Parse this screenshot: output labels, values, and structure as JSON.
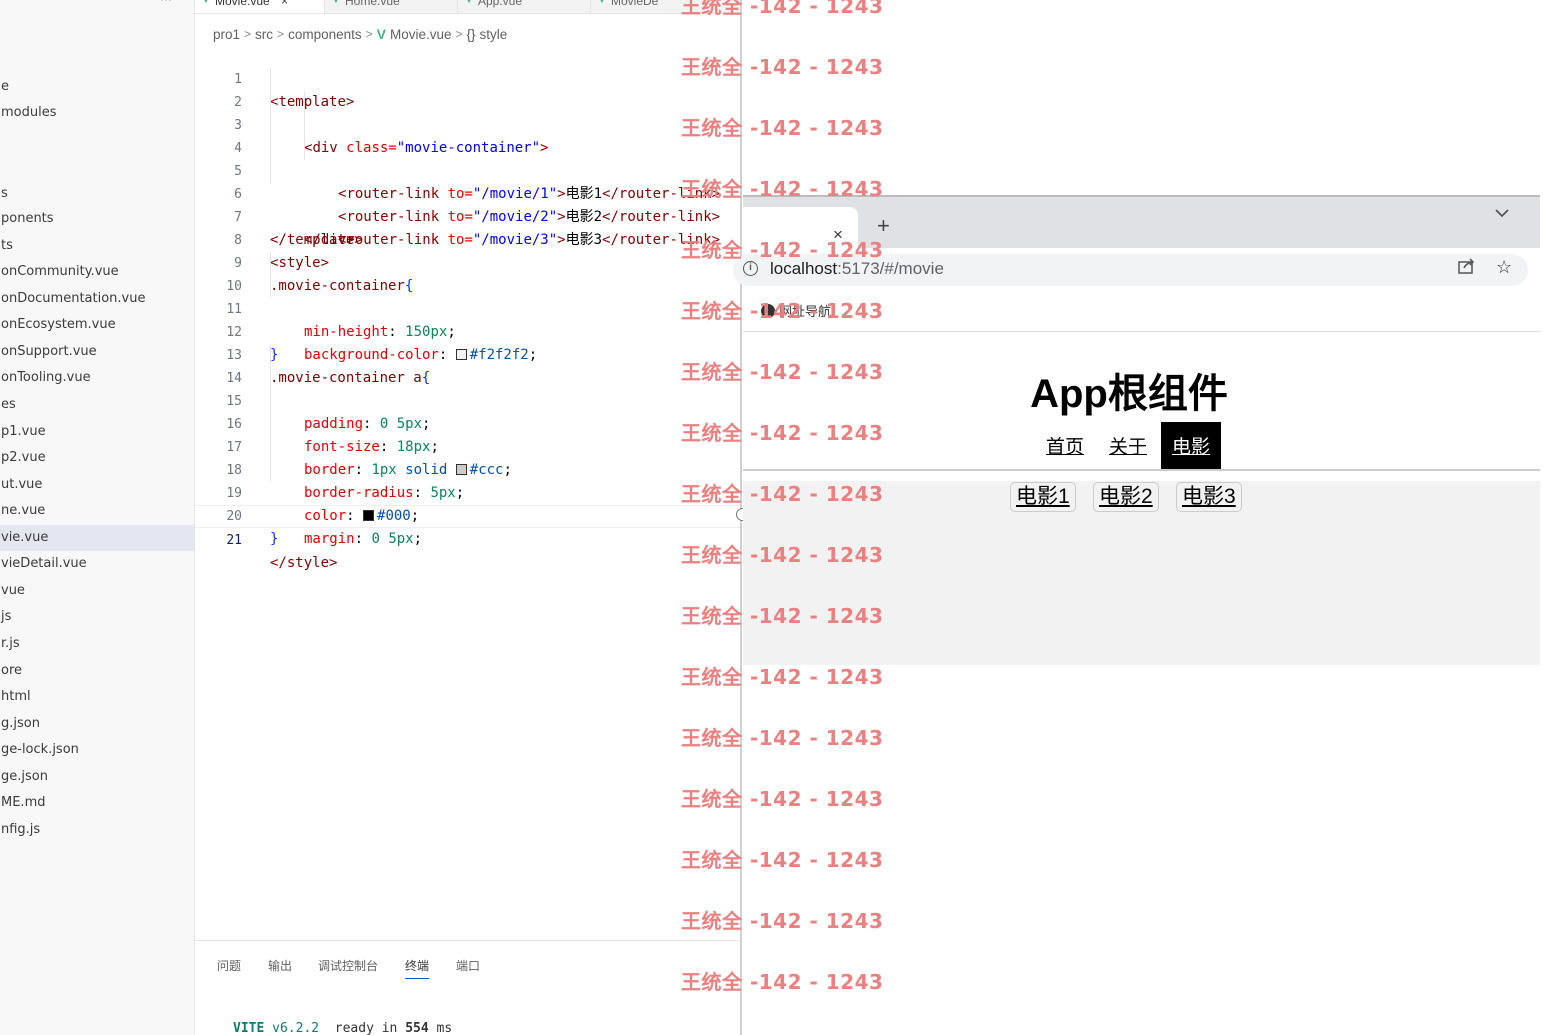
{
  "sidebar": {
    "more": "···",
    "items": [
      {
        "label": "e"
      },
      {
        "label": "modules"
      },
      {
        "label": ""
      },
      {
        "label": "s"
      },
      {
        "label": "ponents"
      },
      {
        "label": "ts"
      },
      {
        "label": "onCommunity.vue"
      },
      {
        "label": "onDocumentation.vue"
      },
      {
        "label": "onEcosystem.vue"
      },
      {
        "label": "onSupport.vue"
      },
      {
        "label": "onTooling.vue"
      },
      {
        "label": "es"
      },
      {
        "label": "p1.vue"
      },
      {
        "label": "p2.vue"
      },
      {
        "label": "ut.vue"
      },
      {
        "label": "ne.vue"
      },
      {
        "label": "vie.vue"
      },
      {
        "label": "vieDetail.vue"
      },
      {
        "label": "vue"
      },
      {
        "label": "js"
      },
      {
        "label": "r.js"
      },
      {
        "label": "ore"
      },
      {
        "label": "html"
      },
      {
        "label": "g.json"
      },
      {
        "label": "ge-lock.json"
      },
      {
        "label": "ge.json"
      },
      {
        "label": "ME.md"
      },
      {
        "label": "nfig.js"
      }
    ]
  },
  "editor": {
    "tabs": [
      {
        "label": "Movie.vue",
        "close": "×"
      },
      {
        "label": "Home.vue"
      },
      {
        "label": "App.vue"
      },
      {
        "label": "MovieDe"
      }
    ],
    "breadcrumb": {
      "part1": "pro1",
      "part2": "src",
      "part3": "components",
      "file": "Movie.vue",
      "braces": "{}",
      "symbol": "style",
      "sep": ">"
    },
    "line_numbers": [
      "1",
      "2",
      "3",
      "4",
      "5",
      "6",
      "7",
      "8",
      "9",
      "10",
      "11",
      "12",
      "13",
      "14",
      "15",
      "16",
      "17",
      "18",
      "19",
      "20",
      "21"
    ],
    "code": {
      "lt": "<",
      "gt": ">",
      "lt_slash": "</",
      "template": "template",
      "div": "div",
      "class_attr": " class=",
      "movie_container_str": "\"movie-container\"",
      "router_link": "router-link",
      "to_attr": " to=",
      "to1": "\"/movie/1\"",
      "to2": "\"/movie/2\"",
      "to3": "\"/movie/3\"",
      "text1": "电影1",
      "text2": "电影2",
      "text3": "电影3",
      "style": "style",
      "sel1": ".movie-container",
      "sel2": ".movie-container a",
      "open_brace": "{",
      "close_brace": "}",
      "colon": ": ",
      "semi": ";",
      "p_min_height": "min-height",
      "v_150": "150px",
      "p_bg": "background-color",
      "v_f2": "#f2f2f2",
      "p_padding": "padding",
      "v_0": "0",
      "v_5px": "5px",
      "space": " ",
      "p_font": "font-size",
      "v_18": "18px",
      "p_border": "border",
      "v_1px": "1px",
      "v_solid": "solid",
      "v_ccc": "#ccc",
      "p_radius": "border-radius",
      "p_color": "color",
      "v_000": "#000",
      "p_margin": "margin"
    }
  },
  "panel": {
    "tabs": [
      "问题",
      "输出",
      "调试控制台",
      "终端",
      "端口"
    ],
    "active_tab": "终端",
    "terminal": {
      "vite": "VITE",
      "version": "v6.2.2",
      "ready": "ready in",
      "ms_value": "554",
      "ms_unit": "ms"
    }
  },
  "browser": {
    "tab_close": "×",
    "new_tab": "+",
    "tab_search": "⌄",
    "url_host": "localhost",
    "url_rest": ":5173/#/movie",
    "bookmark": "网址导航",
    "page": {
      "title": "App根组件",
      "nav": [
        {
          "label": "首页"
        },
        {
          "label": "关于"
        },
        {
          "label": "电影",
          "active": true
        }
      ],
      "movies": [
        "电影1",
        "电影2",
        "电影3"
      ]
    }
  },
  "watermark": {
    "text": "王统全 -142 - 1243"
  },
  "colors": {
    "vue_green": "#41b883",
    "movie_bg": "#f2f2f2",
    "watermark": "#ea8080",
    "nav_active_bg": "#000000"
  }
}
